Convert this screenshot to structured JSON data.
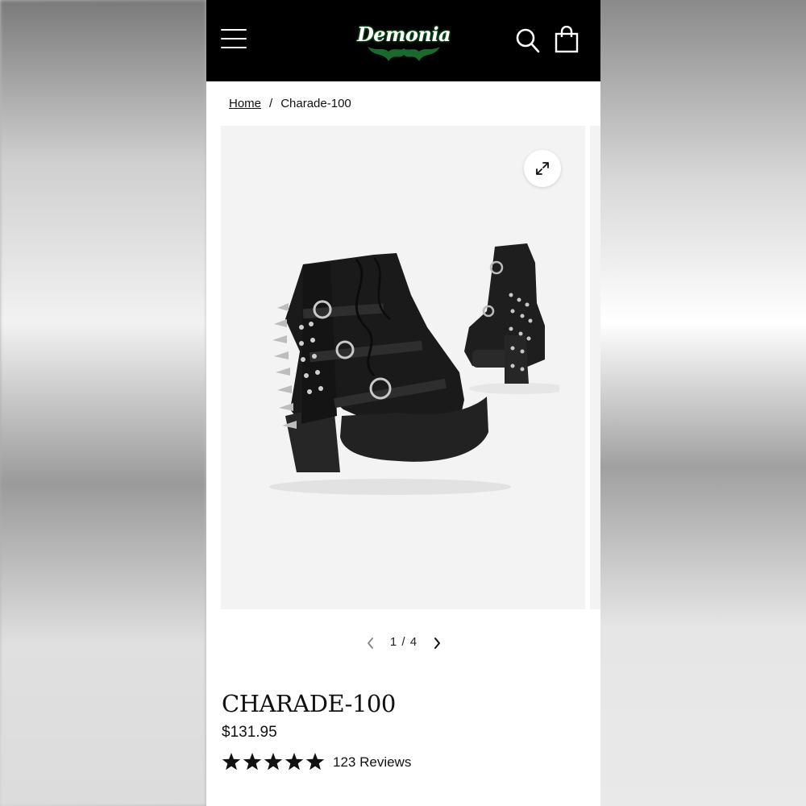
{
  "header": {
    "logo_text": "Demonia",
    "menu_icon": "hamburger-menu-icon",
    "search_icon": "search-icon",
    "cart_icon": "shopping-bag-icon"
  },
  "breadcrumb": {
    "home": "Home",
    "separator": "/",
    "current": "Charade-100"
  },
  "gallery": {
    "expand_icon": "expand-icon",
    "current": "1",
    "separator": "/",
    "total": "4",
    "pager_text": "1 / 4"
  },
  "product": {
    "title": "CHARADE-100",
    "price": "$131.95",
    "rating": 5,
    "rating_max": 5,
    "reviews_text": "123 Reviews"
  },
  "colors": {
    "header_bg": "#000000",
    "logo_accent": "#2db54a",
    "gallery_bg": "#f3f3f3",
    "text": "#111111"
  }
}
